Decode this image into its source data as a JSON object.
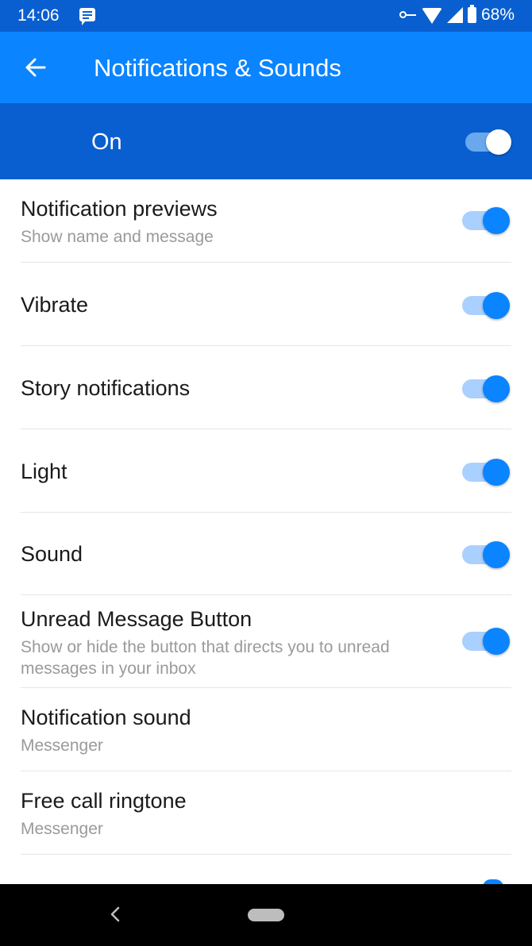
{
  "status_bar": {
    "time": "14:06",
    "battery": "68%"
  },
  "app_bar": {
    "title": "Notifications & Sounds",
    "back_icon": "arrow-left-icon"
  },
  "master_switch": {
    "label": "On",
    "enabled": true
  },
  "settings": [
    {
      "title": "Notification previews",
      "subtitle": "Show name and message",
      "toggle": true
    },
    {
      "title": "Vibrate",
      "subtitle": "",
      "toggle": true
    },
    {
      "title": "Story notifications",
      "subtitle": "",
      "toggle": true
    },
    {
      "title": "Light",
      "subtitle": "",
      "toggle": true
    },
    {
      "title": "Sound",
      "subtitle": "",
      "toggle": true
    },
    {
      "title": "Unread Message Button",
      "subtitle": "Show or hide the button that directs you to unread messages in your inbox",
      "toggle": true
    },
    {
      "title": "Notification sound",
      "subtitle": "Messenger",
      "toggle": null
    },
    {
      "title": "Free call ringtone",
      "subtitle": "Messenger",
      "toggle": null
    }
  ],
  "colors": {
    "accent": "#0a84ff",
    "header_dark": "#0a5fd0",
    "toggle_track": "#a9d0ff"
  }
}
